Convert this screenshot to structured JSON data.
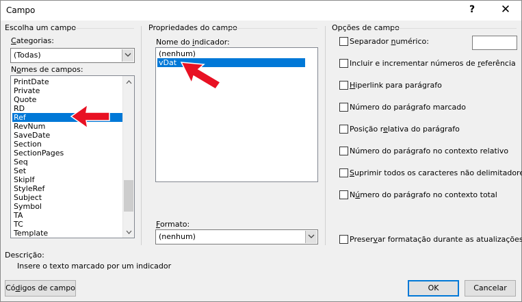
{
  "window": {
    "title": "Campo",
    "help_glyph": "?",
    "close_glyph": "✕"
  },
  "choose_field": {
    "group_title": "Escolha um campo",
    "categories_label_pre": "",
    "categories_label_u": "C",
    "categories_label_post": "ategorias:",
    "categories_value": "(Todas)",
    "field_names_label_pre": "N",
    "field_names_label_u": "o",
    "field_names_label_post": "mes de campos:",
    "field_names": [
      "PrintDate",
      "Private",
      "Quote",
      "RD",
      "Ref",
      "RevNum",
      "SaveDate",
      "Section",
      "SectionPages",
      "Seq",
      "Set",
      "SkipIf",
      "StyleRef",
      "Subject",
      "Symbol",
      "TA",
      "TC",
      "Template"
    ],
    "selected_index": 4
  },
  "field_properties": {
    "group_title": "Propriedades do campo",
    "bookmark_label_pre": "Nome do ",
    "bookmark_label_u": "i",
    "bookmark_label_post": "ndicador:",
    "bookmarks": [
      "(nenhum)",
      "vDat"
    ],
    "selected_index": 1,
    "format_label_pre": "",
    "format_label_u": "F",
    "format_label_post": "ormato:",
    "format_value": "(nenhum)"
  },
  "field_options": {
    "group_title": "Opções de campo",
    "options": [
      {
        "pre": "Separador ",
        "u": "n",
        "post": "umérico:"
      },
      {
        "pre": "Incluir e incrementar números de ",
        "u": "r",
        "post": "eferência"
      },
      {
        "pre": "",
        "u": "H",
        "post": "iperlink para parágrafo"
      },
      {
        "pre": "Número do parágrafo marcado",
        "u": "",
        "post": ""
      },
      {
        "pre": "Posição r",
        "u": "e",
        "post": "lativa do parágrafo"
      },
      {
        "pre": "Número do parágrafo no contexto relativo",
        "u": "",
        "post": ""
      },
      {
        "pre": "",
        "u": "S",
        "post": "uprimir todos os caracteres não delimitadores"
      },
      {
        "pre": "N",
        "u": "ú",
        "post": "mero do parágrafo no contexto total"
      }
    ],
    "preserve_pre": "Preser",
    "preserve_u": "v",
    "preserve_post": "ar formatação durante as atualizações"
  },
  "description": {
    "label": "Descrição:",
    "text": "Insere o texto marcado por um indicador"
  },
  "buttons": {
    "field_codes_pre": "Có",
    "field_codes_u": "d",
    "field_codes_post": "igos de campo",
    "ok": "OK",
    "cancel": "Cancelar"
  },
  "colors": {
    "selection": "#0078d7",
    "arrow": "#e81123"
  }
}
